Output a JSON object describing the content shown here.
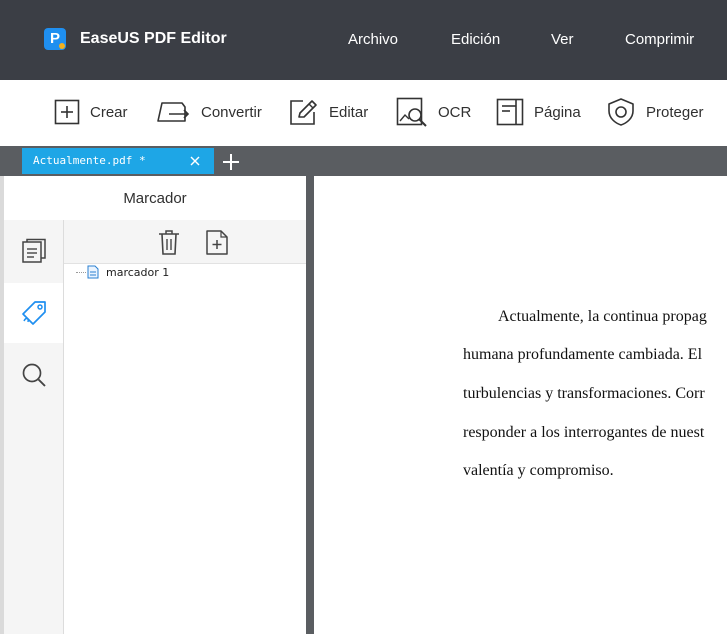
{
  "app": {
    "title": "EaseUS PDF Editor",
    "logo_letter": "P"
  },
  "menu": {
    "items": [
      "Archivo",
      "Edición",
      "Ver",
      "Comprimir"
    ]
  },
  "toolbar": {
    "crear": "Crear",
    "convertir": "Convertir",
    "editar": "Editar",
    "ocr": "OCR",
    "pagina": "Página",
    "proteger": "Proteger"
  },
  "tabs": [
    {
      "label": "Actualmente.pdf *"
    }
  ],
  "sidebar": {
    "title": "Marcador",
    "bookmarks": [
      {
        "label": "marcador 1"
      }
    ]
  },
  "document": {
    "lines": [
      "Actualmente, la continua propag",
      "humana profundamente cambiada. El",
      "turbulencias y transformaciones. Corr",
      "responder a los interrogantes de nuest",
      "valentía y compromiso."
    ]
  },
  "colors": {
    "titlebar": "#3b3e45",
    "tab_active": "#1ea6e6",
    "tabbar": "#5a5d61",
    "accent_blue": "#1f8ff0"
  },
  "icons": {
    "logo": "easeus-logo-icon",
    "crear": "plus-box-icon",
    "convertir": "convert-icon",
    "editar": "edit-pencil-icon",
    "ocr": "ocr-scan-icon",
    "pagina": "page-icon",
    "proteger": "shield-icon"
  }
}
